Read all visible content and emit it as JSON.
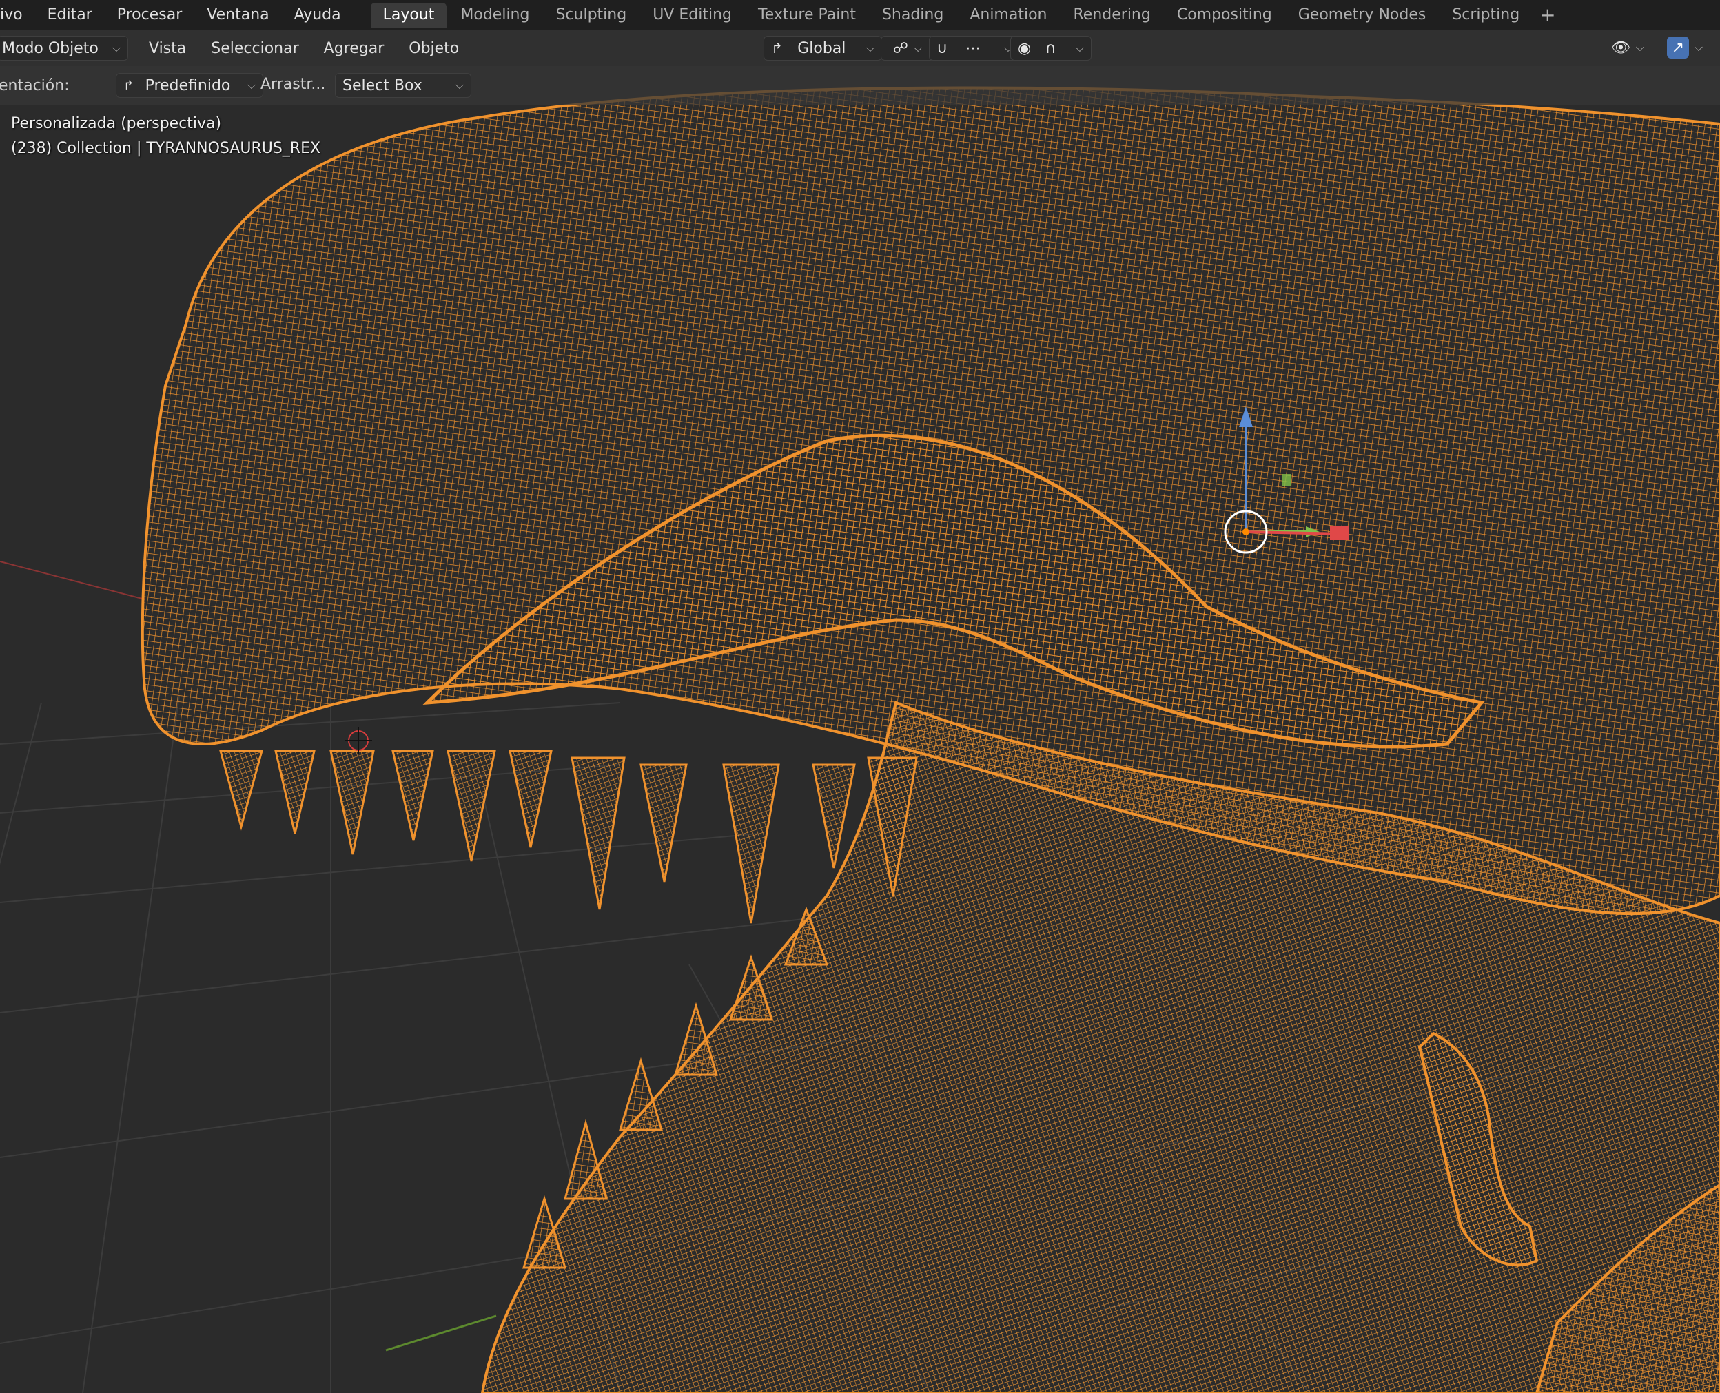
{
  "menu": {
    "items": [
      "ivo",
      "Editar",
      "Procesar",
      "Ventana",
      "Ayuda"
    ]
  },
  "workspaces": {
    "tabs": [
      "Layout",
      "Modeling",
      "Sculpting",
      "UV Editing",
      "Texture Paint",
      "Shading",
      "Animation",
      "Rendering",
      "Compositing",
      "Geometry Nodes",
      "Scripting"
    ],
    "active": "Layout",
    "add_label": "+"
  },
  "header": {
    "mode_label": "Modo Objeto",
    "view_menu": [
      "Vista",
      "Seleccionar",
      "Agregar",
      "Objeto"
    ],
    "orientation_value": "Global"
  },
  "tool_settings": {
    "orientation_label": "entación:",
    "pivot_value": "Predefinido",
    "drag_label": "Arrastr...",
    "select_value": "Select Box"
  },
  "viewport": {
    "view_name": "Personalizada (perspectiva)",
    "collection_info": "(238) Collection | TYRANNOSAURUS_REX",
    "wire_color": "#f0922d",
    "background": "#2b2b2b"
  }
}
